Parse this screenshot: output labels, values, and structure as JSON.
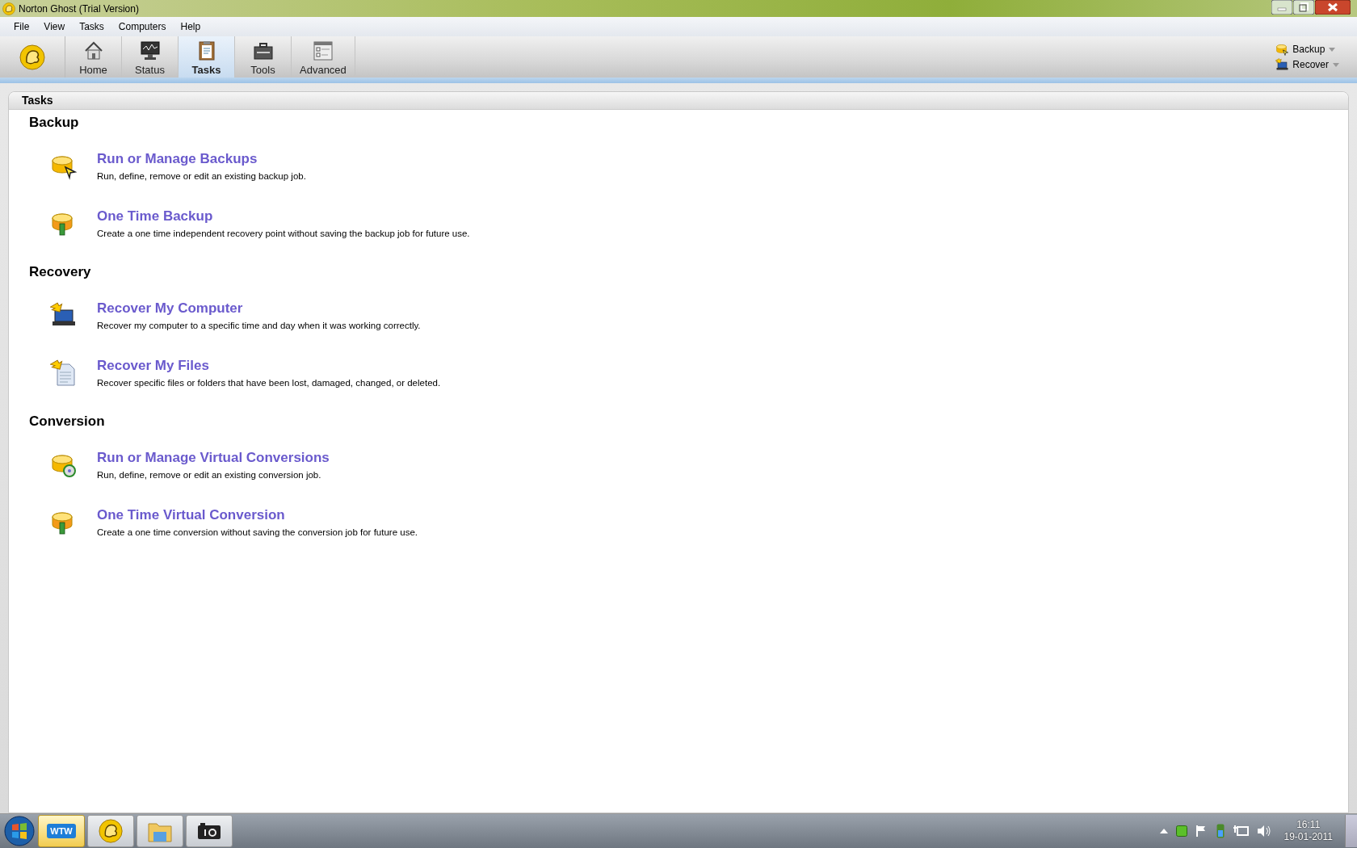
{
  "window": {
    "title": "Norton Ghost (Trial Version)"
  },
  "menu": [
    "File",
    "View",
    "Tasks",
    "Computers",
    "Help"
  ],
  "toolbar": {
    "tabs": [
      {
        "label": "Home",
        "kind": "home",
        "selected": false
      },
      {
        "label": "Status",
        "kind": "status",
        "selected": false
      },
      {
        "label": "Tasks",
        "kind": "tasks",
        "selected": true
      },
      {
        "label": "Tools",
        "kind": "tools",
        "selected": false
      },
      {
        "label": "Advanced",
        "kind": "advanced",
        "selected": false
      }
    ],
    "quick_actions": [
      {
        "label": "Backup",
        "kind": "backup"
      },
      {
        "label": "Recover",
        "kind": "recover"
      }
    ]
  },
  "panel": {
    "title": "Tasks",
    "sections": [
      {
        "heading": "Backup",
        "items": [
          {
            "title": "Run or Manage Backups",
            "description": "Run, define, remove or edit an existing backup job.",
            "kind": "manage-backup"
          },
          {
            "title": "One Time Backup",
            "description": "Create a one time independent recovery point without saving the backup job for future use.",
            "kind": "one-time"
          }
        ]
      },
      {
        "heading": "Recovery",
        "items": [
          {
            "title": "Recover My Computer",
            "description": "Recover my computer to a specific time and day when it was working correctly.",
            "kind": "recover-computer"
          },
          {
            "title": "Recover My Files",
            "description": "Recover specific files or folders that have been lost, damaged, changed, or deleted.",
            "kind": "recover-files"
          }
        ]
      },
      {
        "heading": "Conversion",
        "items": [
          {
            "title": "Run or Manage Virtual Conversions",
            "description": "Run, define, remove or edit an existing conversion job.",
            "kind": "manage-conversion"
          },
          {
            "title": "One Time Virtual Conversion",
            "description": "Create a one time conversion without saving the conversion job for future use.",
            "kind": "one-time"
          }
        ]
      }
    ]
  },
  "taskbar": {
    "apps": [
      {
        "kind": "chat",
        "label": "WTW",
        "selected": true
      },
      {
        "kind": "ghost",
        "selected": false
      },
      {
        "kind": "folder",
        "selected": false
      },
      {
        "kind": "camera",
        "selected": false
      }
    ],
    "clock": {
      "time": "16:11",
      "date": "19-01-2011"
    }
  }
}
